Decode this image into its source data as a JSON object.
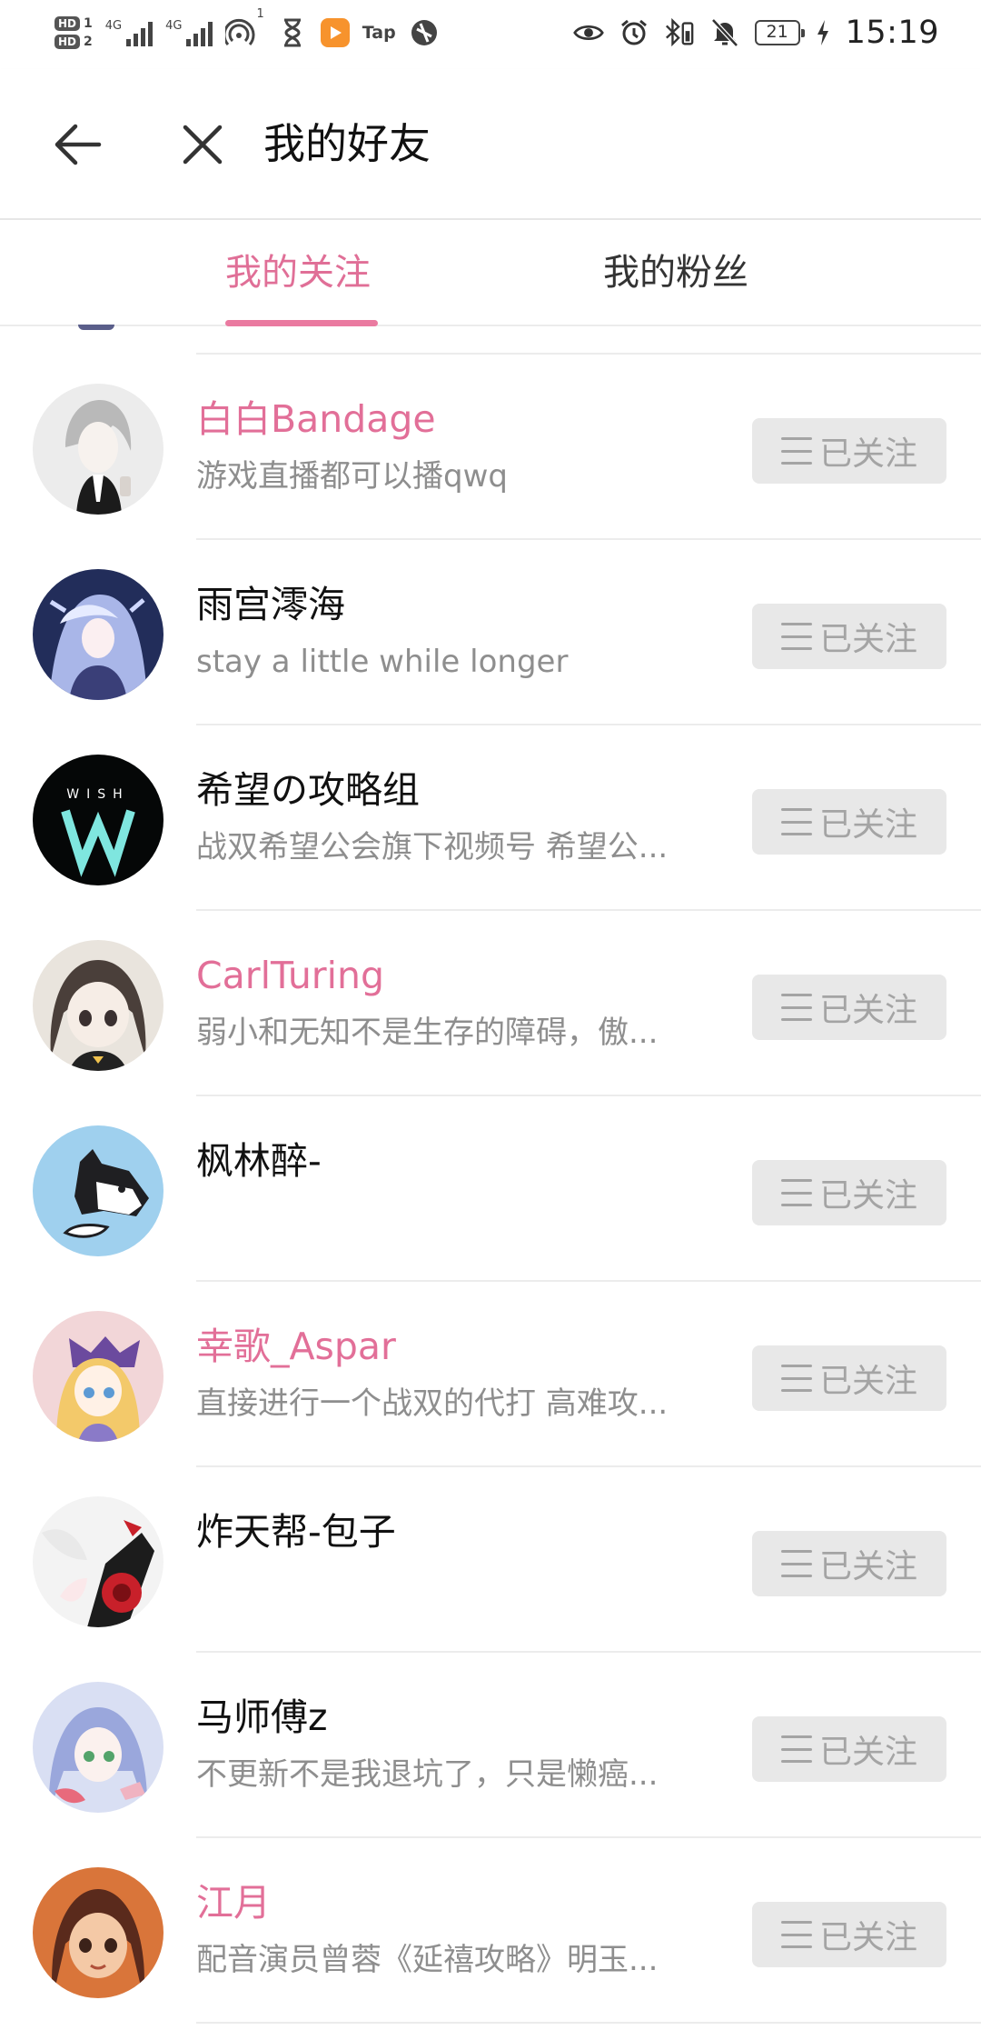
{
  "status_bar": {
    "sim1": "HD",
    "sim1_num": "1",
    "sim2": "HD",
    "sim2_num": "2",
    "network1": "4G",
    "network2": "4G",
    "hotspot_count": "1",
    "tap_label": "Tap",
    "battery": "21",
    "time": "15:19"
  },
  "header": {
    "title": "我的好友"
  },
  "tabs": [
    {
      "label": "我的关注",
      "active": true
    },
    {
      "label": "我的粉丝",
      "active": false
    }
  ],
  "colors": {
    "accent": "#e26f98",
    "button_bg": "#e8e8e8",
    "button_text": "#a4a4a4"
  },
  "follow_button_label": "已关注",
  "users": [
    {
      "name": "白白Bandage",
      "desc": "游戏直播都可以播qwq",
      "highlighted": true
    },
    {
      "name": "雨宫澪海",
      "desc": "stay a little while longer",
      "highlighted": false
    },
    {
      "name": "希望の攻略组",
      "desc": "战双希望公会旗下视频号 希望公...",
      "highlighted": false
    },
    {
      "name": "CarlTuring",
      "desc": "弱小和无知不是生存的障碍，傲...",
      "highlighted": true
    },
    {
      "name": "枫林醉-",
      "desc": "",
      "highlighted": false
    },
    {
      "name": "幸歌_Aspar",
      "desc": "直接进行一个战双的代打 高难攻...",
      "highlighted": true
    },
    {
      "name": "炸天帮-包子",
      "desc": "",
      "highlighted": false
    },
    {
      "name": "马师傅z",
      "desc": "不更新不是我退坑了，只是懒癌...",
      "highlighted": false
    },
    {
      "name": "江月",
      "desc": "配音演员曾蓉《延禧攻略》明玉...",
      "highlighted": true
    }
  ]
}
